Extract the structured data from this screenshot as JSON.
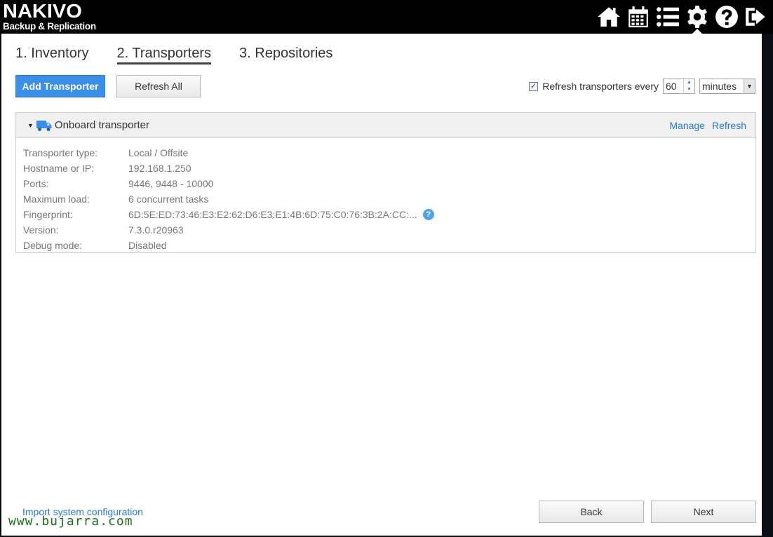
{
  "app": {
    "logo_main": "NAKIVO",
    "logo_sub": "Backup & Replication"
  },
  "top_icons": [
    "home-icon",
    "calendar-icon",
    "list-icon",
    "gear-icon",
    "help-icon",
    "logout-icon"
  ],
  "steps": [
    {
      "label": "1. Inventory"
    },
    {
      "label": "2. Transporters"
    },
    {
      "label": "3. Repositories"
    }
  ],
  "toolbar": {
    "add_label": "Add Transporter",
    "refresh_all_label": "Refresh All",
    "refresh_option_label": "Refresh transporters every",
    "refresh_checked": true,
    "refresh_interval": "60",
    "refresh_unit": "minutes"
  },
  "transporter": {
    "name": "Onboard transporter",
    "manage_label": "Manage",
    "refresh_label": "Refresh",
    "properties": [
      {
        "label": "Transporter type:",
        "value": "Local / Offsite"
      },
      {
        "label": "Hostname or IP:",
        "value": "192.168.1.250"
      },
      {
        "label": "Ports:",
        "value": "9446, 9448 - 10000"
      },
      {
        "label": "Maximum load:",
        "value": "6 concurrent tasks"
      },
      {
        "label": "Fingerprint:",
        "value": "6D:5E:ED:73:46:E3:E2:62:D6:E3:E1:4B:6D:75:C0:76:3B:2A:CC:..."
      },
      {
        "label": "Version:",
        "value": "7.3.0.r20963"
      },
      {
        "label": "Debug mode:",
        "value": "Disabled"
      }
    ]
  },
  "footer": {
    "import_label": "Import system configuration",
    "back_label": "Back",
    "next_label": "Next"
  },
  "watermark": "www.bujarra.com",
  "colors": {
    "primary": "#3b8fe8",
    "link": "#2a7ac7",
    "watermark": "#1f6d1f"
  }
}
